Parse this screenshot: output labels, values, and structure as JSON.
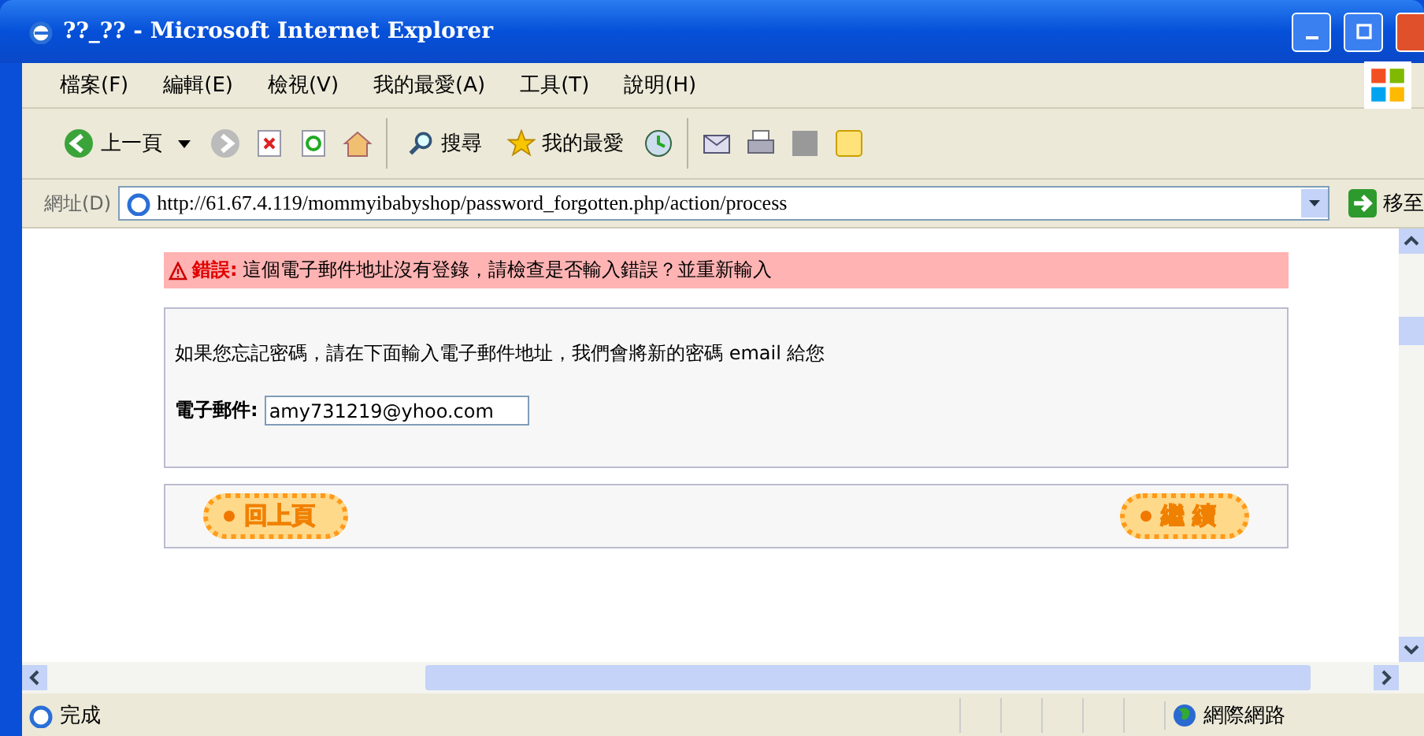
{
  "window": {
    "title": "??_?? - Microsoft Internet Explorer"
  },
  "menu": [
    "檔案(F)",
    "編輯(E)",
    "檢視(V)",
    "我的最愛(A)",
    "工具(T)",
    "說明(H)"
  ],
  "toolbar": {
    "back": "上一頁",
    "search": "搜尋",
    "favorites": "我的最愛"
  },
  "address": {
    "label": "網址(D)",
    "url": "http://61.67.4.119/mommyibabyshop/password_forgotten.php/action/process",
    "go": "移至"
  },
  "error": {
    "label": "錯誤:",
    "message": "這個電子郵件地址沒有登錄，請檢查是否輸入錯誤？並重新輸入"
  },
  "form": {
    "intro": "如果您忘記密碼，請在下面輸入電子郵件地址，我們會將新的密碼 email 給您",
    "email_label": "電子郵件:",
    "email_value": "amy731219@yhoo.com"
  },
  "buttons": {
    "back": "回上頁",
    "continue": "繼 續"
  },
  "status_bar": {
    "status": "完成",
    "zone": "網際網路"
  }
}
